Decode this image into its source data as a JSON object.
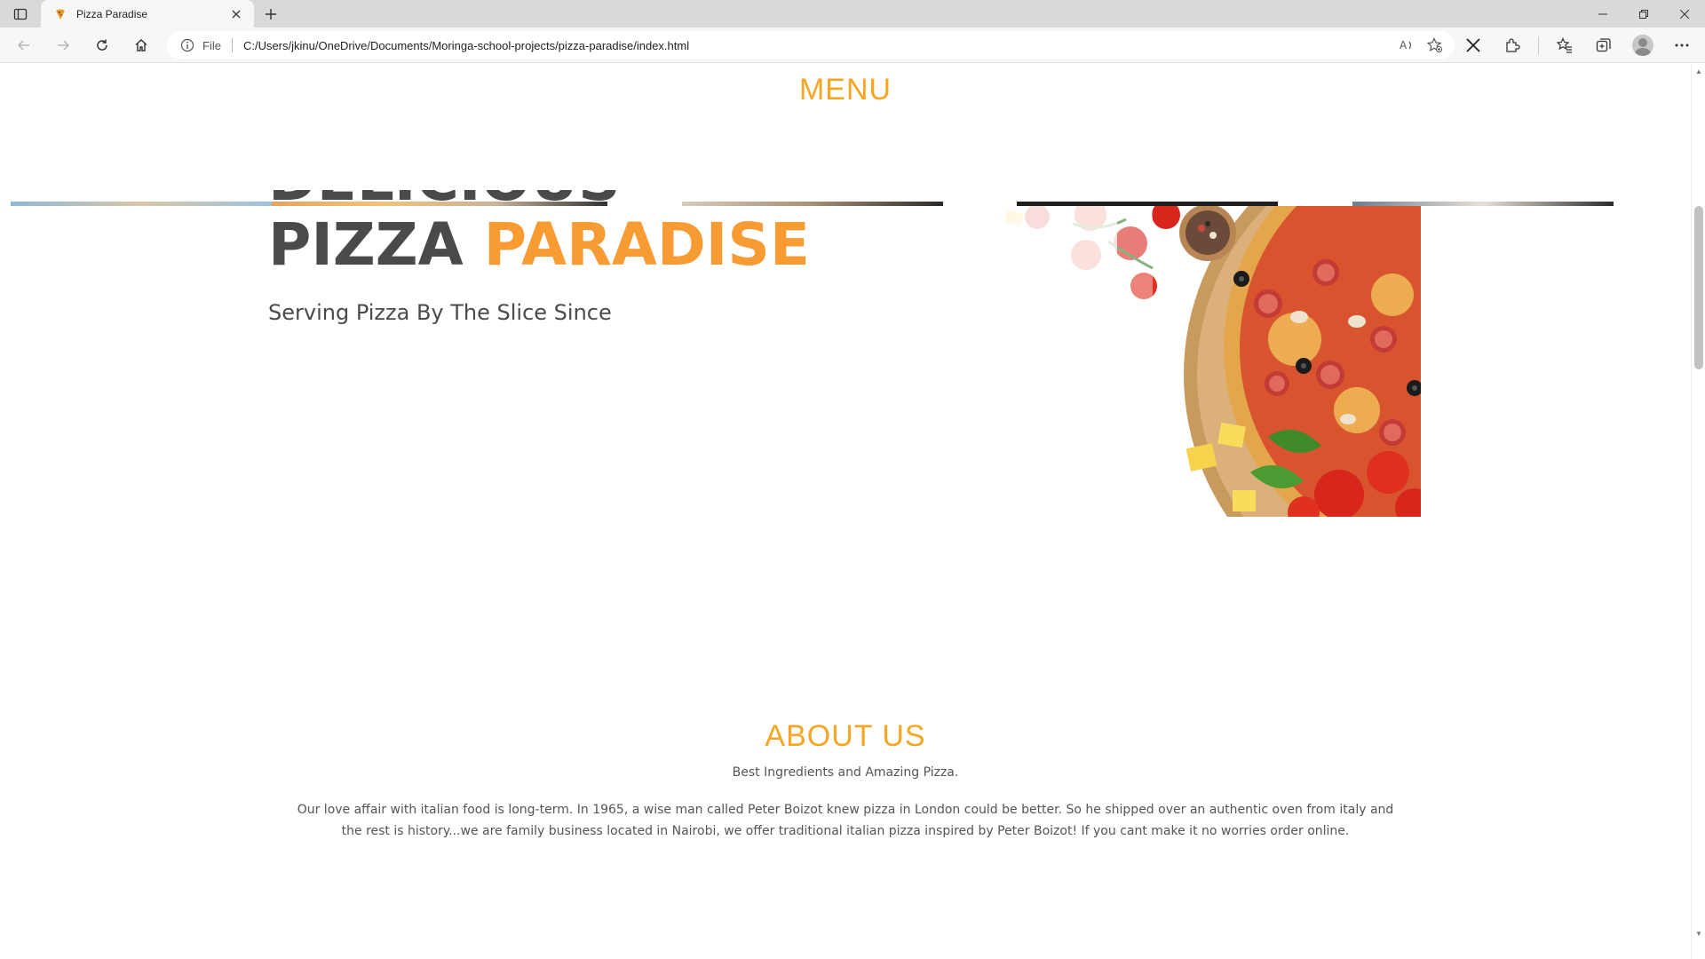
{
  "browser": {
    "tab_title": "Pizza Paradise",
    "address_scheme": "File",
    "url": "C:/Users/jkinu/OneDrive/Documents/Moringa-school-projects/pizza-paradise/index.html"
  },
  "page": {
    "menu_heading": "MENU",
    "hero": {
      "line1": "DELICIOUS",
      "line2_plain": "PIZZA",
      "line2_accent": "PARADISE",
      "subtitle": "Serving Pizza By The Slice Since"
    },
    "about": {
      "heading": "ABOUT US",
      "tagline": "Best Ingredients and Amazing Pizza.",
      "body": "Our love affair with italian food is long-term. In 1965, a wise man called Peter Boizot knew pizza in London could be better. So he shipped over an authentic oven from italy and the rest is history...we are family business located in Nairobi, we offer traditional italian pizza inspired by Peter Boizot! If you cant make it no worries order online."
    }
  },
  "colors": {
    "accent": "#f5a623",
    "hero_accent": "#f99b33",
    "text_dark": "#4a4a4a"
  }
}
